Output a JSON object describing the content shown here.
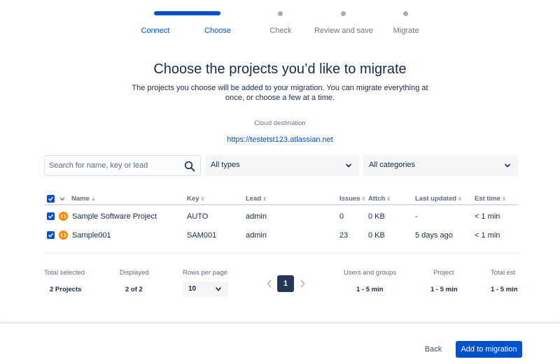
{
  "stepper": {
    "steps": [
      {
        "label": "Connect",
        "state": "done"
      },
      {
        "label": "Choose",
        "state": "current"
      },
      {
        "label": "Check",
        "state": "pending"
      },
      {
        "label": "Review and save",
        "state": "pending"
      },
      {
        "label": "Migrate",
        "state": "pending"
      }
    ]
  },
  "page": {
    "title": "Choose the projects you’d like to migrate",
    "subtitle": "The projects you choose will be added to your migration. You can migrate everything at once, or choose a few at a time.",
    "destination_label": "Cloud destination",
    "destination_url": "https://testetst123.atlassian.net"
  },
  "filters": {
    "search_placeholder": "Search for name, key or lead",
    "type_select": "All types",
    "category_select": "All categories"
  },
  "table": {
    "columns": [
      "Name",
      "Key",
      "Lead",
      "Issues",
      "Attch",
      "Last updated",
      "Est time"
    ],
    "rows": [
      {
        "name": "Sample Software Project",
        "key": "AUTO",
        "lead": "admin",
        "issues": "0",
        "attch": "0 KB",
        "last_updated": "-",
        "est_time": "< 1 min",
        "checked": true
      },
      {
        "name": "Sample001",
        "key": "SAM001",
        "lead": "admin",
        "issues": "23",
        "attch": "0 KB",
        "last_updated": "5 days ago",
        "est_time": "< 1 min",
        "checked": true
      }
    ]
  },
  "summary": {
    "total_selected_label": "Total selected",
    "total_selected_value": "2 Projects",
    "displayed_label": "Displayed",
    "displayed_value": "2 of 2",
    "rows_per_page_label": "Rows per page",
    "rows_per_page_value": "10",
    "current_page": "1",
    "users_groups_label": "Users and groups",
    "users_groups_value": "1 - 5 min",
    "project_label": "Project",
    "project_value": "1 - 5 min",
    "total_est_label": "Total est",
    "total_est_value": "1 - 5 min"
  },
  "footer": {
    "back_label": "Back",
    "add_label": "Add to migration"
  },
  "colors": {
    "primary": "#0052cc",
    "project_icon": "#ff8b00",
    "page_active": "#253858"
  }
}
